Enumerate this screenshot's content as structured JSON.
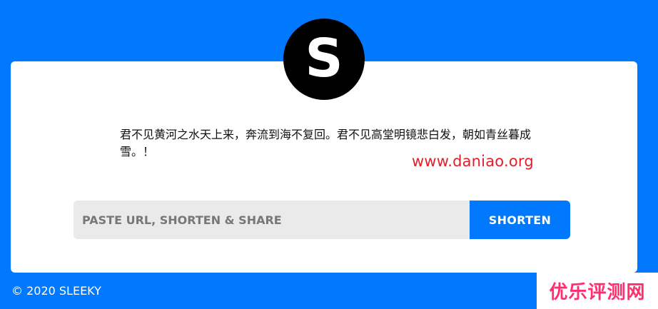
{
  "logo": {
    "letter": "S"
  },
  "content": {
    "message": "君不见黄河之水天上来，奔流到海不复回。君不见高堂明镜悲白发，朝如青丝暮成雪。！",
    "site_watermark": "www.daniao.org"
  },
  "form": {
    "placeholder": "PASTE URL, SHORTEN & SHARE",
    "button_label": "SHORTEN"
  },
  "footer": {
    "copyright": "© 2020 SLEEKY"
  },
  "watermark": {
    "text": "优乐评测网"
  },
  "colors": {
    "background": "#0079ff",
    "panel": "#ffffff",
    "logo_background": "#000000",
    "button": "#0079ff",
    "input_background": "#eaeaea",
    "site_watermark": "#e0202a",
    "corner_watermark": "#ff2f6d"
  }
}
